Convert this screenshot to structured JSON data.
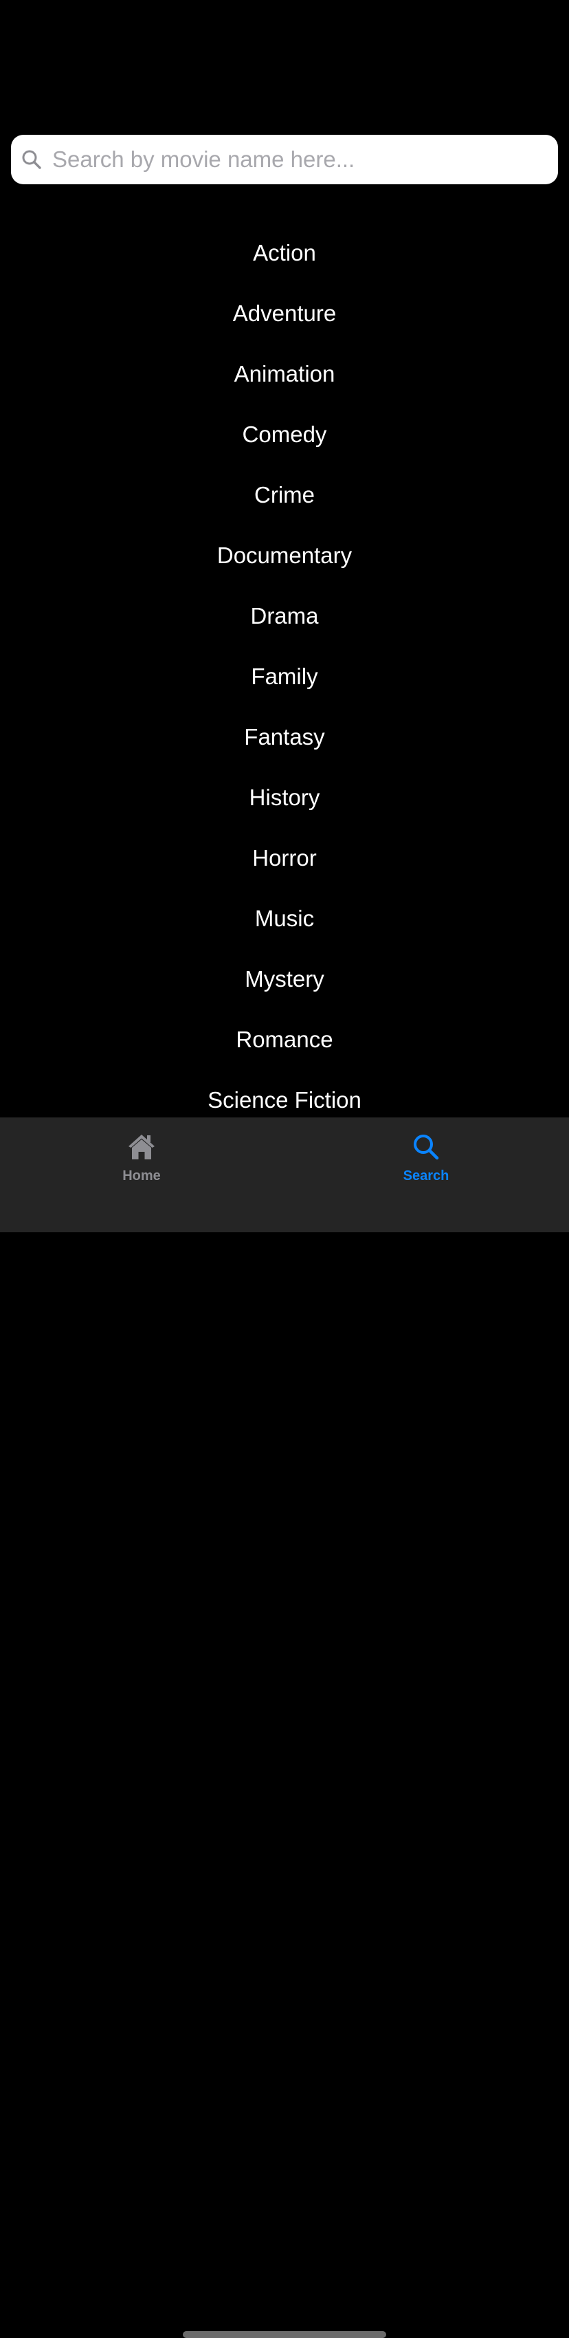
{
  "search": {
    "placeholder": "Search by movie name here...",
    "value": ""
  },
  "genres": [
    "Action",
    "Adventure",
    "Animation",
    "Comedy",
    "Crime",
    "Documentary",
    "Drama",
    "Family",
    "Fantasy",
    "History",
    "Horror",
    "Music",
    "Mystery",
    "Romance",
    "Science Fiction"
  ],
  "tab_bar": {
    "tabs": [
      {
        "label": "Home",
        "icon": "house-icon",
        "active": false
      },
      {
        "label": "Search",
        "icon": "magnifying-glass-icon",
        "active": true
      }
    ]
  },
  "colors": {
    "background": "#000000",
    "tab_bar": "#252525",
    "accent": "#0a84ff",
    "inactive": "#8e8e93"
  }
}
